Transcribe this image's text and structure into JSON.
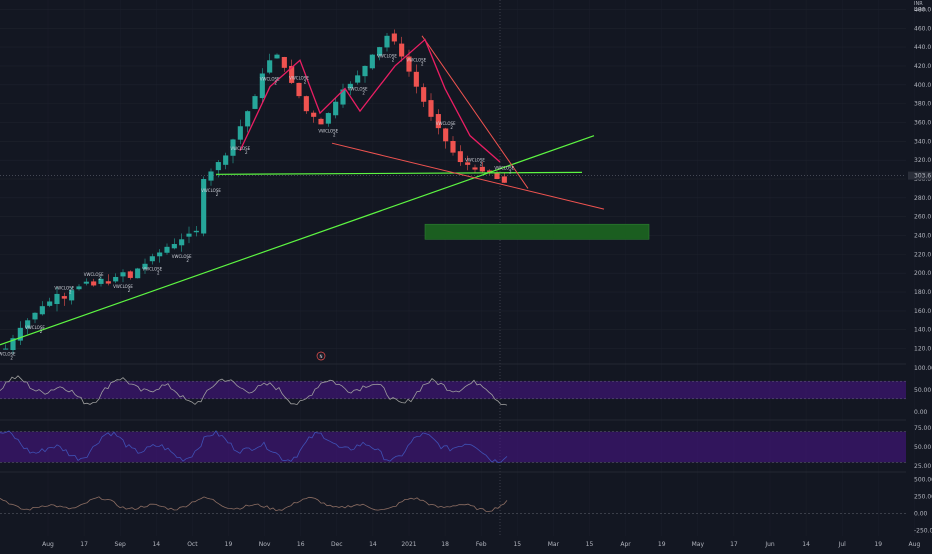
{
  "colors": {
    "background": "#131722",
    "grid": "#1e222d",
    "up": "#26a69a",
    "down": "#ef5350",
    "trendline": "#5df542",
    "pattern": "#e91e63",
    "channel": "#ef5350",
    "target_box": "#1b5e20",
    "band": "#4a148c",
    "osc_line": "#9e9e9e",
    "osc2_line": "#3f51b5",
    "osc3_line": "#8d6e63"
  },
  "header": {
    "currency": "INR",
    "unit": "Lakh"
  },
  "signal_labels": {
    "sell": "VWCLOSE",
    "count": "2",
    "circle": "N"
  },
  "chart_data": [
    {
      "type": "line",
      "name": "price",
      "x_labels": [
        "Aug",
        "17",
        "Sep",
        "14",
        "Oct",
        "19",
        "Nov",
        "16",
        "Dec",
        "14",
        "2021",
        "18",
        "Feb",
        "15",
        "Mar",
        "15",
        "Apr",
        "19",
        "May",
        "17",
        "Jun",
        "14",
        "Jul",
        "19",
        "Aug"
      ],
      "y_ticks": [
        120,
        140,
        160,
        180,
        200,
        220,
        240,
        260,
        280,
        300,
        320,
        340,
        360,
        380,
        400,
        420,
        440,
        460,
        480
      ],
      "ylim": [
        110,
        490
      ],
      "last_price": 303.6,
      "series": [
        {
          "values": [
            120,
            131,
            142,
            150,
            158,
            165,
            170,
            178,
            173,
            182,
            186,
            191,
            187,
            194,
            189,
            196,
            201,
            195,
            205,
            210,
            218,
            222,
            228,
            231,
            236,
            242,
            245,
            300,
            308,
            318,
            325,
            342,
            356,
            372,
            388,
            412,
            426,
            432,
            418,
            402,
            388,
            372,
            366,
            358,
            370,
            382,
            395,
            401,
            410,
            420,
            432,
            440,
            452,
            446,
            430,
            414,
            398,
            382,
            366,
            354,
            340,
            328,
            318,
            315,
            310,
            308,
            306,
            300,
            296
          ]
        }
      ],
      "annotations": {
        "resistance_level": 305,
        "target_zone": [
          236,
          252
        ]
      }
    },
    {
      "type": "area",
      "name": "oscillator-1",
      "y_ticks": [
        0.0,
        50.0,
        100.0
      ],
      "ylim": [
        0,
        100
      ],
      "band": [
        30,
        70
      ]
    },
    {
      "type": "area",
      "name": "oscillator-2",
      "y_ticks": [
        25.0,
        50.0,
        75.0
      ],
      "ylim": [
        20,
        80
      ],
      "band": [
        30,
        70
      ]
    },
    {
      "type": "line",
      "name": "oscillator-3",
      "y_ticks": [
        -250.0,
        0.0,
        250.0,
        500.0
      ],
      "ylim": [
        -300,
        550
      ]
    }
  ]
}
